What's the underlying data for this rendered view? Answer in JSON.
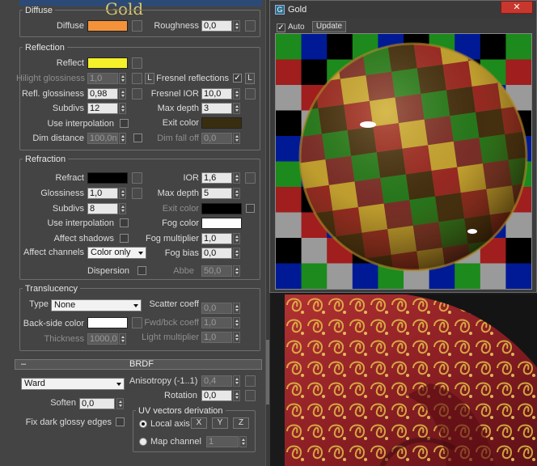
{
  "top": {
    "title": "Gold",
    "section": "Diffuse"
  },
  "diffuse": {
    "label": "Diffuse",
    "color": "#f4923a",
    "roughness_label": "Roughness",
    "roughness": "0,0"
  },
  "reflection": {
    "title": "Reflection",
    "reflect_label": "Reflect",
    "reflect_color": "#f4f02a",
    "hilight_label": "Hilight glossiness",
    "hilight": "1,0",
    "hilight_lock": "L",
    "fresnel_label": "Fresnel reflections",
    "fresnel_lock": "L",
    "refl_gloss_label": "Refl. glossiness",
    "refl_gloss": "0,98",
    "fresnel_ior_label": "Fresnel IOR",
    "fresnel_ior": "10,0",
    "subdivs_label": "Subdivs",
    "subdivs": "12",
    "maxdepth_label": "Max depth",
    "maxdepth": "3",
    "interp_label": "Use interpolation",
    "exit_label": "Exit color",
    "exit_color": "#3a2e10",
    "dimdist_label": "Dim distance",
    "dimdist": "100,0n",
    "dimfall_label": "Dim fall off",
    "dimfall": "0,0"
  },
  "refraction": {
    "title": "Refraction",
    "refract_label": "Refract",
    "refract_color": "#000000",
    "ior_label": "IOR",
    "ior": "1,6",
    "gloss_label": "Glossiness",
    "gloss": "1,0",
    "maxdepth_label": "Max depth",
    "maxdepth": "5",
    "subdivs_label": "Subdivs",
    "subdivs": "8",
    "exit_label": "Exit color",
    "exit_color": "#000000",
    "interp_label": "Use interpolation",
    "fog_label": "Fog color",
    "fog_color": "#ffffff",
    "affect_shadows_label": "Affect shadows",
    "fog_mult_label": "Fog multiplier",
    "fog_mult": "1,0",
    "affect_ch_label": "Affect channels",
    "affect_ch": "Color only",
    "fog_bias_label": "Fog bias",
    "fog_bias": "0,0",
    "dispersion_label": "Dispersion",
    "abbe_label": "Abbe",
    "abbe": "50,0"
  },
  "translucency": {
    "title": "Translucency",
    "type_label": "Type",
    "type": "None",
    "scatter_label": "Scatter coeff",
    "scatter": "0,0",
    "backside_label": "Back-side color",
    "backside_color": "#ffffff",
    "fwd_label": "Fwd/bck coeff",
    "fwd": "1,0",
    "thickness_label": "Thickness",
    "thickness": "1000,0",
    "light_label": "Light multiplier",
    "light": "1,0"
  },
  "brdf": {
    "collapse": "–",
    "title": "BRDF",
    "type": "Ward",
    "aniso_label": "Anisotropy (-1..1)",
    "aniso": "0,4",
    "rotation_label": "Rotation",
    "rotation": "0,0",
    "soften_label": "Soften",
    "soften": "0,0",
    "fixdark_label": "Fix dark glossy edges",
    "uv_title": "UV vectors derivation",
    "local_label": "Local axis",
    "x": "X",
    "y": "Y",
    "z": "Z",
    "mapch_label": "Map channel",
    "mapch": "1"
  },
  "preview": {
    "title": "Gold",
    "auto_label": "Auto",
    "update_label": "Update",
    "close": "✕",
    "checker": [
      "#000000",
      "#1c8a1c",
      "#001a96",
      "#a01e1e",
      "#9a9a9a"
    ]
  }
}
